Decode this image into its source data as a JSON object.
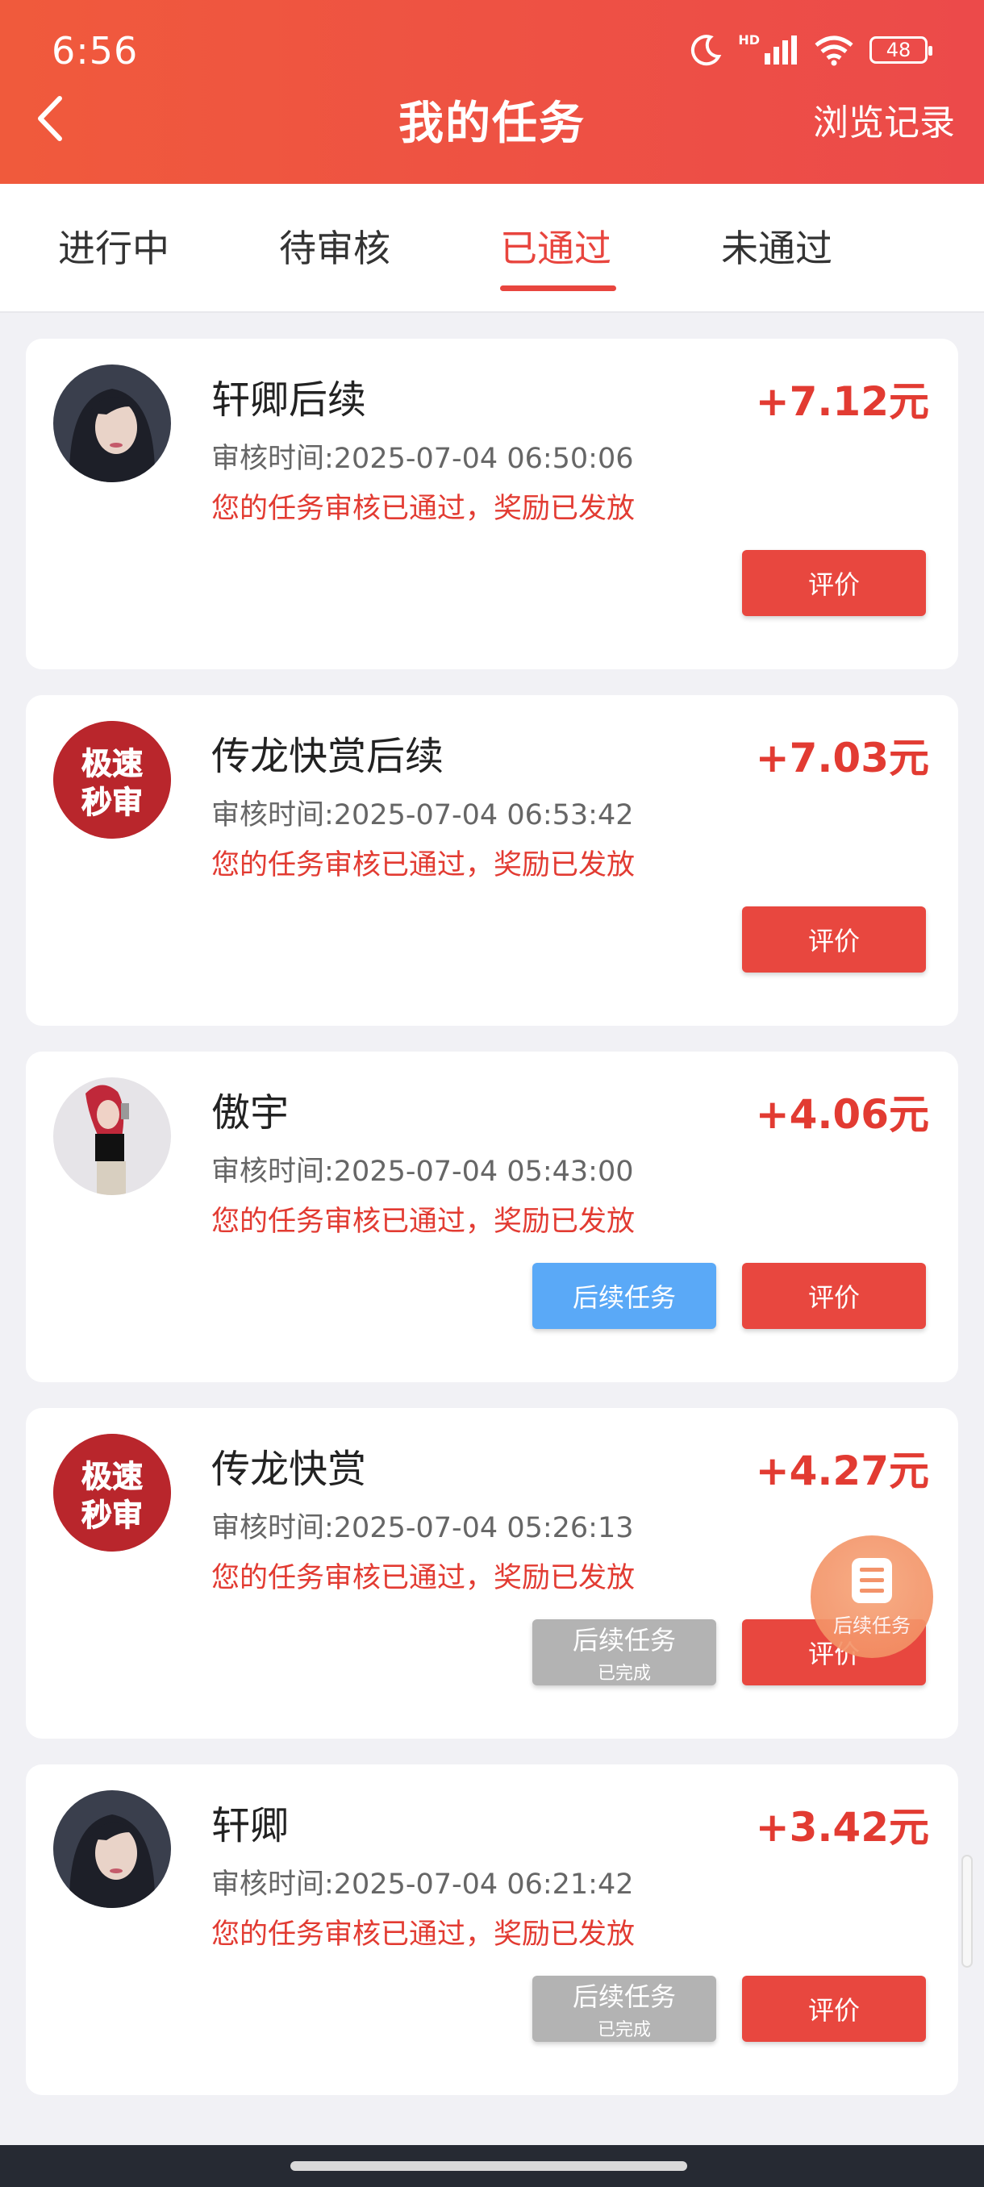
{
  "status_bar": {
    "time": "6:56",
    "battery": "48",
    "network_label": "HD"
  },
  "header": {
    "title": "我的任务",
    "history_label": "浏览记录"
  },
  "tabs": [
    {
      "label": "进行中"
    },
    {
      "label": "待审核"
    },
    {
      "label": "已通过"
    },
    {
      "label": "未通过"
    }
  ],
  "active_tab": "已通过",
  "tasks": [
    {
      "title": "轩卿后续",
      "amount": "+7.12元",
      "time": "审核时间:2025-07-04 06:50:06",
      "status": "您的任务审核已通过，奖励已发放",
      "avatar": "woman-portrait-icon",
      "eval_label": "评价"
    },
    {
      "title": "传龙快赏后续",
      "amount": "+7.03元",
      "time": "审核时间:2025-07-04 06:53:42",
      "status": "您的任务审核已通过，奖励已发放",
      "avatar": "logo",
      "avatar_text": [
        "极速",
        "秒审"
      ],
      "eval_label": "评价"
    },
    {
      "title": "傲宇",
      "amount": "+4.06元",
      "time": "审核时间:2025-07-04 05:43:00",
      "status": "您的任务审核已通过，奖励已发放",
      "avatar": "woman-photo-icon",
      "follow_label": "后续任务",
      "eval_label": "评价"
    },
    {
      "title": "传龙快赏",
      "amount": "+4.27元",
      "time": "审核时间:2025-07-04 05:26:13",
      "status": "您的任务审核已通过，奖励已发放",
      "avatar": "logo",
      "avatar_text": [
        "极速",
        "秒审"
      ],
      "follow_label": "后续任务",
      "follow_sub": "已完成",
      "eval_label": "评价"
    },
    {
      "title": "轩卿",
      "amount": "+3.42元",
      "time": "审核时间:2025-07-04 06:21:42",
      "status": "您的任务审核已通过，奖励已发放",
      "avatar": "woman-portrait-icon",
      "follow_label": "后续任务",
      "follow_sub": "已完成",
      "eval_label": "评价"
    }
  ],
  "floating_button": {
    "label": "后续任务"
  },
  "colors": {
    "accent": "#e8453e",
    "header_start": "#f05a3c",
    "header_end": "#ec4a4a",
    "follow_blue": "#5aa9f7",
    "done_gray": "#b3b3b3"
  }
}
